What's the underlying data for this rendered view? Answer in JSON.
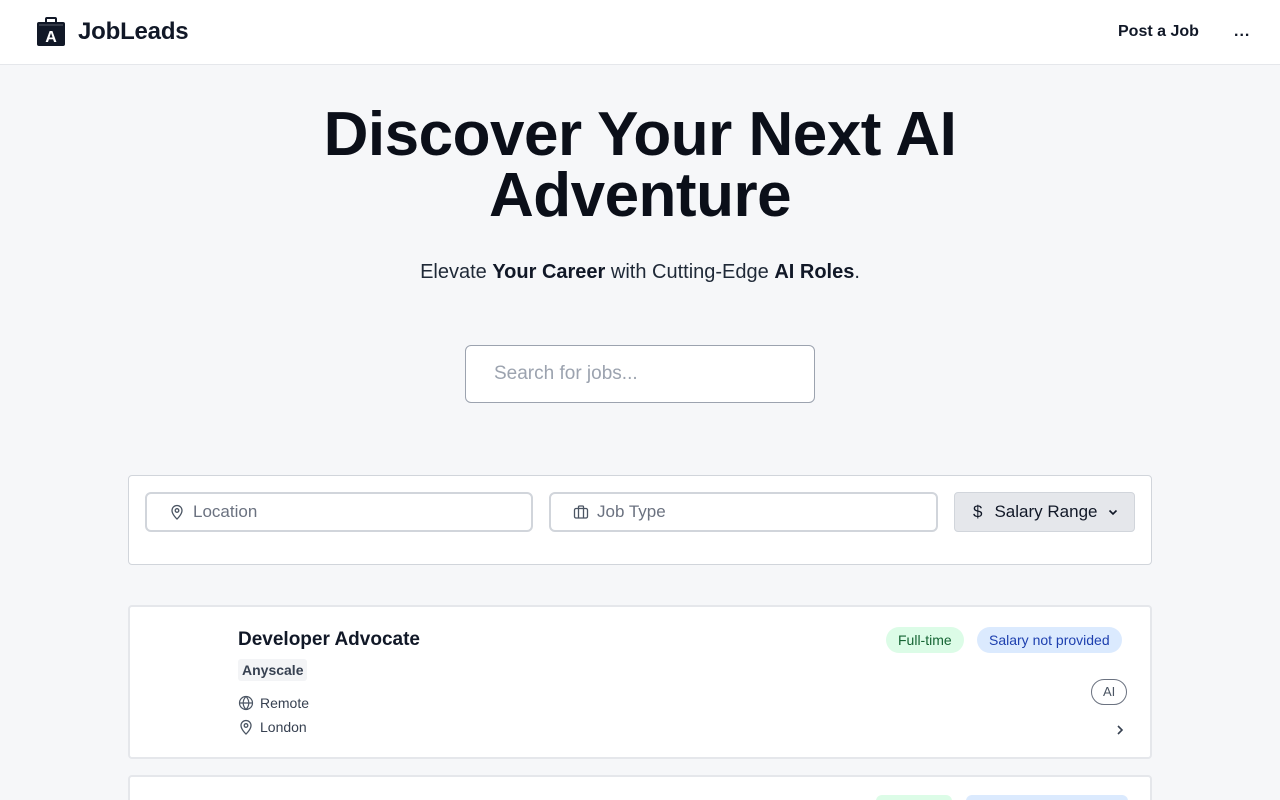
{
  "header": {
    "brand_name": "JobLeads",
    "logo_letter": "A",
    "nav_post_job": "Post a Job",
    "nav_more": "..."
  },
  "hero": {
    "title_line1": "Discover Your Next AI",
    "title_line2": "Adventure",
    "subtitle_parts": [
      "Elevate ",
      "Your Career",
      " with Cutting-Edge ",
      "AI Roles",
      "."
    ],
    "search_placeholder": "Search for jobs..."
  },
  "filters": {
    "location_placeholder": "Location",
    "job_type_placeholder": "Job Type",
    "salary_label": "Salary Range",
    "salary_symbol": "$"
  },
  "jobs": [
    {
      "title": "Developer Advocate",
      "company": "Anyscale",
      "work_mode": "Remote",
      "city": "London",
      "employment_type": "Full-time",
      "salary": "Salary not provided",
      "category_badge": "AI"
    }
  ],
  "icons": {
    "brand": "briefcase-logo-icon",
    "location": "map-pin-icon",
    "job_type": "briefcase-icon",
    "salary_dropdown": "chevron-down-icon",
    "remote": "globe-icon",
    "card_open": "chevron-right-icon"
  },
  "colors": {
    "background": "#f6f7f9",
    "full_time_pill_bg": "#dcfce7",
    "full_time_pill_text": "#166534",
    "salary_pill_bg": "#dbeafe",
    "salary_pill_text": "#1e40af"
  }
}
